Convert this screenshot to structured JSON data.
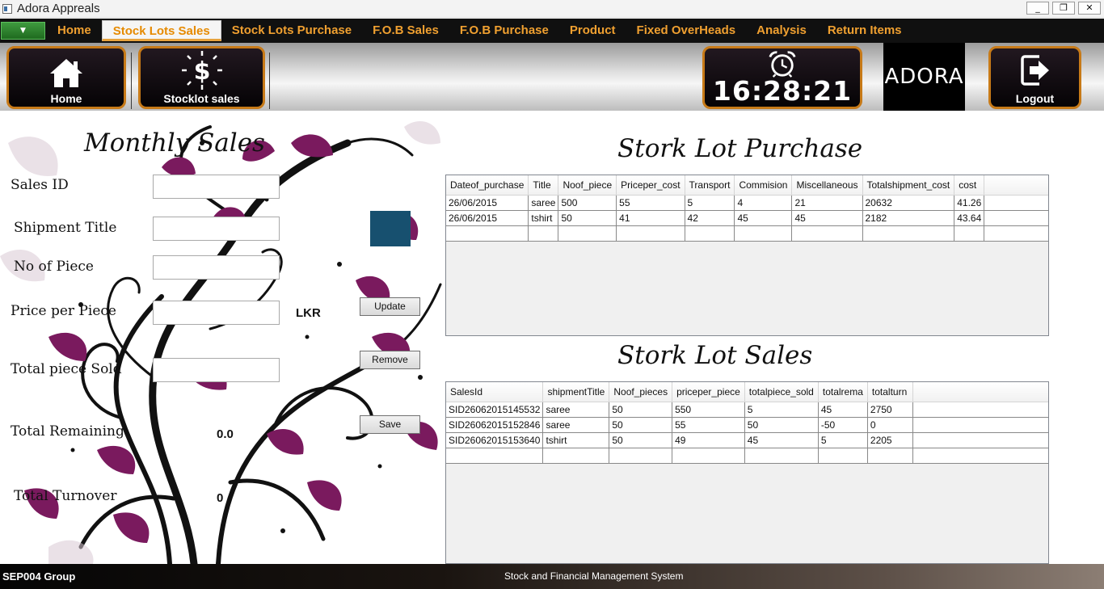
{
  "window": {
    "title": "Adora Appreals",
    "min": "_",
    "restore": "❐",
    "close": "✕"
  },
  "menu": {
    "items": [
      "Home",
      "Stock Lots Sales",
      "Stock Lots Purchase",
      "F.O.B Sales",
      "F.O.B Purchase",
      "Product",
      "Fixed OverHeads",
      "Analysis",
      "Return Items"
    ],
    "active": "Stock Lots Sales"
  },
  "toolbar": {
    "home_label": "Home",
    "stocklot_label": "Stocklot sales",
    "clock_time": "16:28:21",
    "brand": "ADORA",
    "logout_label": "Logout"
  },
  "form": {
    "heading": "Monthly Sales",
    "sales_id_label": "Sales ID",
    "shipment_title_label": "Shipment Title",
    "no_of_piece_label": "No of Piece",
    "price_per_piece_label": "Price per Piece",
    "currency": "LKR",
    "total_piece_sold_label": "Total piece Sold",
    "total_remaining_label": "Total Remaining",
    "total_remaining_value": "0.0",
    "total_turnover_label": "Total Turnover",
    "total_turnover_value": "0",
    "update_label": "Update",
    "remove_label": "Remove",
    "save_label": "Save"
  },
  "purchase": {
    "heading": "Stork Lot Purchase",
    "columns": [
      "Dateof_purchase",
      "Title",
      "Noof_piece",
      "Priceper_cost",
      "Transport",
      "Commision",
      "Miscellaneous",
      "Totalshipment_cost",
      "cost"
    ],
    "rows": [
      [
        "26/06/2015",
        "saree",
        "500",
        "55",
        "5",
        "4",
        "21",
        "20632",
        "41.26"
      ],
      [
        "26/06/2015",
        "tshirt",
        "50",
        "41",
        "42",
        "45",
        "45",
        "2182",
        "43.64"
      ]
    ]
  },
  "sales": {
    "heading": "Stork Lot Sales",
    "columns": [
      "SalesId",
      "shipmentTitle",
      "Noof_pieces",
      "priceper_piece",
      "totalpiece_sold",
      "totalrema",
      "totalturn"
    ],
    "rows": [
      [
        "SID26062015145532",
        "saree",
        "50",
        "550",
        "5",
        "45",
        "2750"
      ],
      [
        "SID26062015152846",
        "saree",
        "50",
        "55",
        "50",
        "-50",
        "0"
      ],
      [
        "SID26062015153640",
        "tshirt",
        "50",
        "49",
        "45",
        "5",
        "2205"
      ]
    ]
  },
  "footer": {
    "group": "SEP004 Group",
    "system": "Stock and Financial Management System"
  },
  "colors": {
    "menu_text": "#f0a030",
    "tile_border": "#c77a18",
    "floral_purple": "#7a1a5e"
  },
  "icons": [
    "app-icon",
    "dropdown-arrow-icon",
    "home-icon",
    "dollar-icon",
    "alarm-clock-icon",
    "logout-icon"
  ]
}
